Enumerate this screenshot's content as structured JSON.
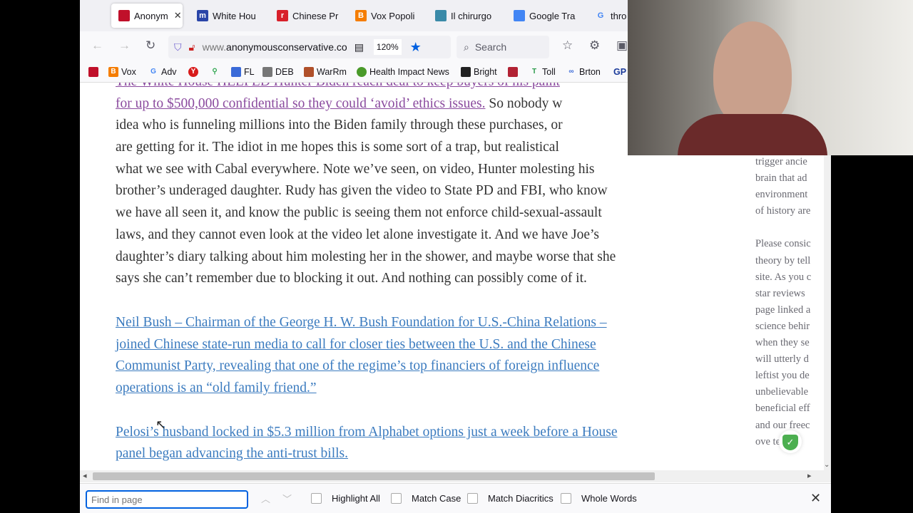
{
  "tabs": [
    {
      "label": "Anonym",
      "color": "#c0102a"
    },
    {
      "label": "White Hou",
      "color": "#2a45a8"
    },
    {
      "label": "Chinese Pr",
      "color": "#d8202a"
    },
    {
      "label": "Vox Popoli",
      "color": "#f57d00"
    },
    {
      "label": "Il chirurgo",
      "color": "#3a8aa8"
    },
    {
      "label": "Google Tra",
      "color": "#4285f4"
    },
    {
      "label": "thro",
      "color": "#4285f4"
    }
  ],
  "nav": {
    "url_prefix": "www.",
    "url_domain": "anonymousconservative.co",
    "zoom": "120%",
    "search": "Search"
  },
  "bookmarks": [
    {
      "label": "",
      "color": "#c0102a"
    },
    {
      "label": "Vox",
      "color": "#f57d00"
    },
    {
      "label": "Adv",
      "color": "#4285f4"
    },
    {
      "label": "",
      "color": "#d81b1b"
    },
    {
      "label": "",
      "color": "#34a853"
    },
    {
      "label": "FL",
      "color": "#3a6ad8"
    },
    {
      "label": "DEB",
      "color": "#777"
    },
    {
      "label": "WarRm",
      "color": "#b0502a"
    },
    {
      "label": "Health Impact News",
      "color": "#4a9a2a"
    },
    {
      "label": "Bright",
      "color": "#222"
    },
    {
      "label": "",
      "color": "#b22234"
    },
    {
      "label": "Toll",
      "color": "#2a9a4a"
    },
    {
      "label": "Brton",
      "color": "#3a6ad8"
    },
    {
      "label": "GP",
      "color": "#1a3a9a"
    }
  ],
  "article": {
    "line0": "The White House HELPED Hunter Biden reach deal to keep buyers of his paint",
    "line1_link": "for up to $500,000 confidential so they could ‘avoid’ ethics issues.",
    "line1_text": " So nobody w",
    "lines": [
      "idea who is funneling millions into the Biden family through these purchases, or",
      "are getting for it. The idiot in me hopes this is some sort of a trap, but realistical",
      "what we see with Cabal everywhere. Note we’ve seen, on video, Hunter molesting his",
      "brother’s underaged daughter. Rudy has given the video to State PD and FBI, who know",
      "we have all seen it, and know the public is seeing them not enforce child-sexual-assault",
      "laws, and they cannot even look at the video let alone investigate it. And we have Joe’s",
      "daughter’s diary talking about him molesting her in the shower, and maybe worse that she",
      "says she can’t remember due to blocking it out. And nothing can possibly come of it."
    ],
    "link2": [
      "Neil Bush – Chairman of the George H. W. Bush Foundation for U.S.-China Relations –",
      "joined Chinese state-run media to call for closer ties between the U.S. and the Chinese",
      "Communist Party, revealing that one of the regime’s top financiers of foreign influence",
      "operations is an “old family friend.”"
    ],
    "link3": [
      "Pelosi’s husband locked in $5.3 million from Alphabet options just a week before a House",
      "panel began advancing the anti-trust bills."
    ]
  },
  "sidebar": [
    "trigger ancie",
    "brain that ad",
    "environment",
    "of history are",
    "",
    "Please consic",
    "theory by tell",
    "site. As you c",
    "star reviews",
    "page linked a",
    "science behir",
    "when they se",
    "will utterly d",
    "leftist you de",
    "unbelievable",
    "beneficial eff",
    "and our freec",
    "ove       te"
  ],
  "find": {
    "placeholder": "Find in page",
    "highlight_all": "Highlight All",
    "match_case": "Match Case",
    "match_diacritics": "Match Diacritics",
    "whole_words": "Whole Words"
  }
}
